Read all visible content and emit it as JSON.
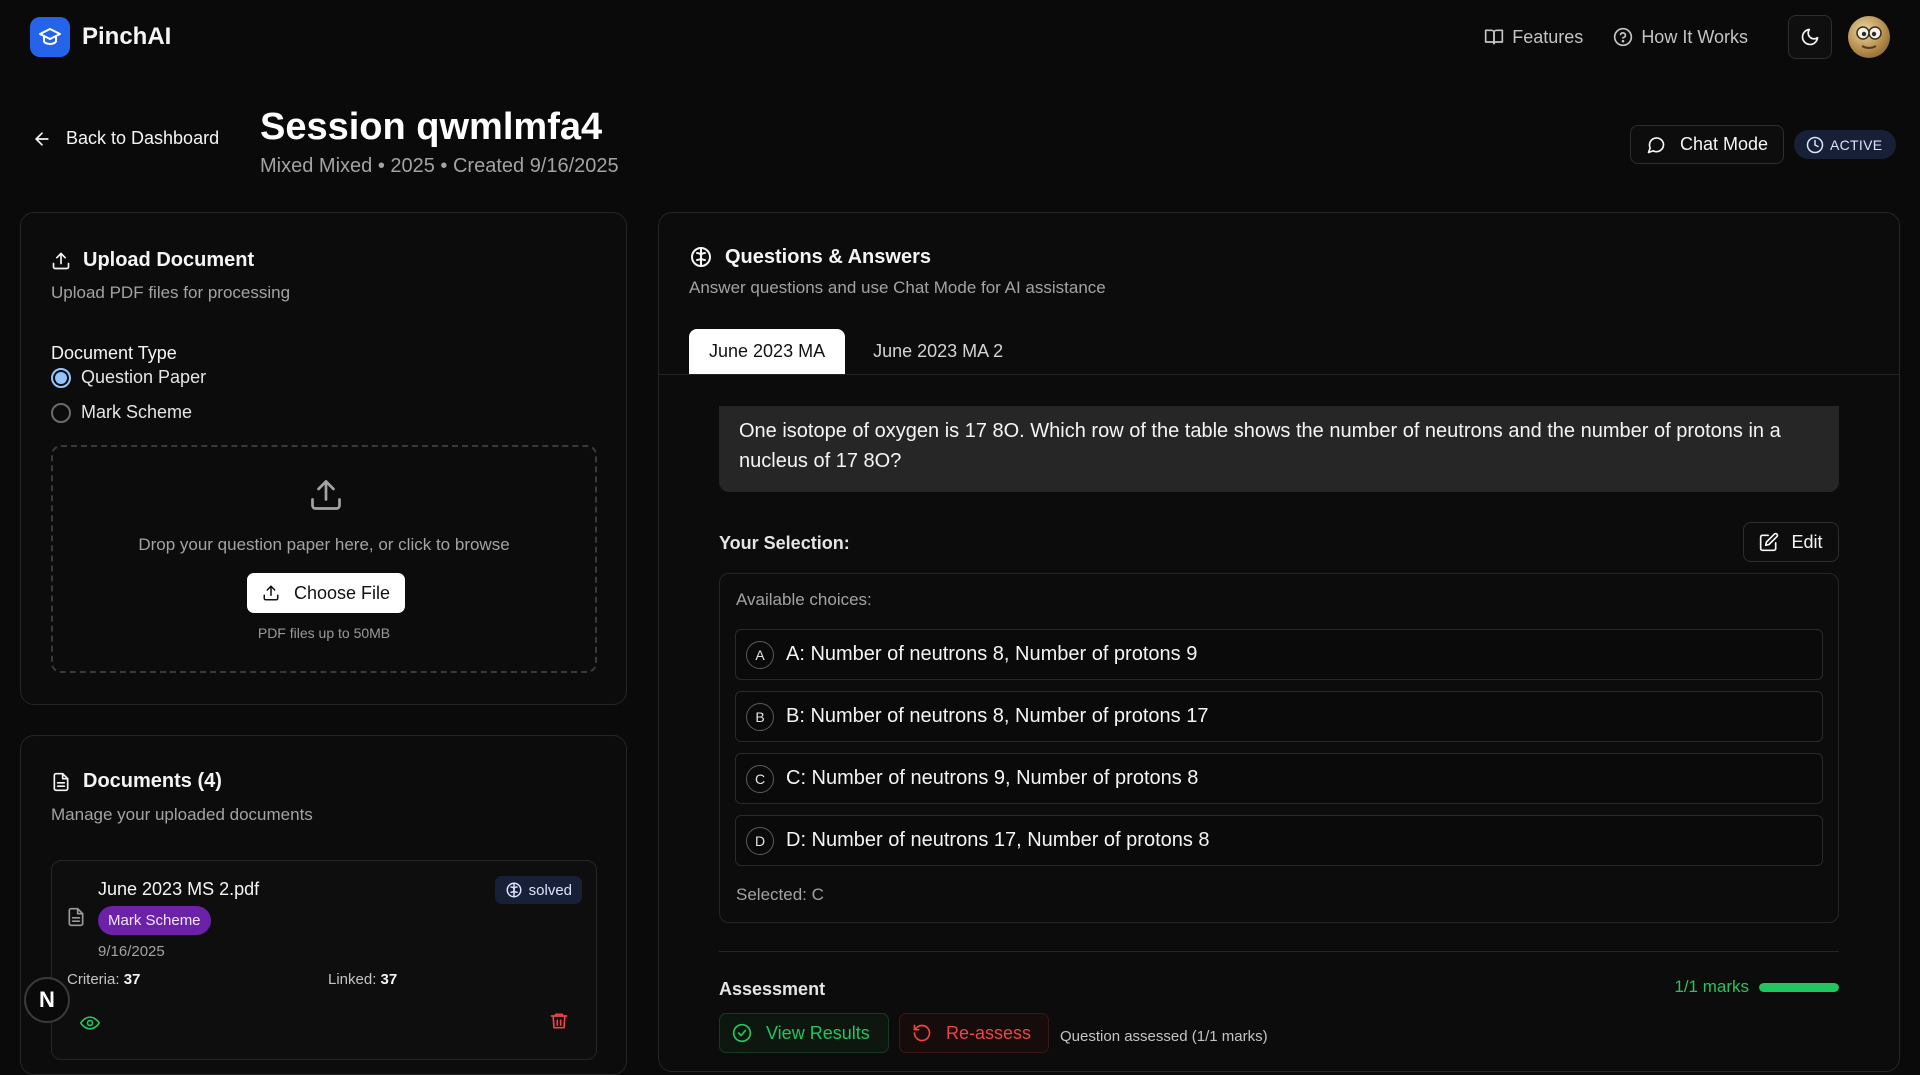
{
  "brand": {
    "name": "PinchAI"
  },
  "nav": {
    "features": "Features",
    "how_it_works": "How It Works"
  },
  "session": {
    "back_label": "Back to Dashboard",
    "title": "Session qwmlmfa4",
    "subtitle": "Mixed Mixed • 2025 • Created 9/16/2025",
    "chat_mode_label": "Chat Mode",
    "status": "ACTIVE"
  },
  "upload": {
    "title": "Upload Document",
    "description": "Upload PDF files for processing",
    "doc_type_label": "Document Type",
    "options": [
      "Question Paper",
      "Mark Scheme"
    ],
    "selected_option": "Question Paper",
    "drop_text": "Drop your question paper here, or click to browse",
    "choose_label": "Choose File",
    "hint": "PDF files up to 50MB"
  },
  "documents": {
    "title": "Documents (4)",
    "description": "Manage your uploaded documents",
    "items": [
      {
        "name": "June 2023 MS 2.pdf",
        "status": "solved",
        "type_tag": "Mark Scheme",
        "date": "9/16/2025",
        "criteria_label": "Criteria:",
        "criteria_value": "37",
        "linked_label": "Linked:",
        "linked_value": "37"
      }
    ]
  },
  "qa": {
    "title": "Questions & Answers",
    "description": "Answer questions and use Chat Mode for AI assistance",
    "tabs": [
      "June 2023 MA",
      "June 2023 MA 2"
    ],
    "active_tab": "June 2023 MA",
    "question_text": "One isotope of oxygen is 17 8O. Which row of the table shows the number of neutrons and the number of protons in a nucleus of 17 8O?",
    "selection_label": "Your Selection:",
    "edit_label": "Edit",
    "choices_title": "Available choices:",
    "choices": [
      {
        "letter": "A",
        "text": "A: Number of neutrons 8, Number of protons 9"
      },
      {
        "letter": "B",
        "text": "B: Number of neutrons 8, Number of protons 17"
      },
      {
        "letter": "C",
        "text": "C: Number of neutrons 9, Number of protons 8"
      },
      {
        "letter": "D",
        "text": "D: Number of neutrons 17, Number of protons 8"
      }
    ],
    "selected_text": "Selected: C",
    "assessment_label": "Assessment",
    "marks_text": "1/1 marks",
    "marks_fraction": 1.0,
    "view_results_label": "View Results",
    "reassess_label": "Re-assess",
    "assessed_text": "Question assessed (1/1 marks)"
  },
  "floating_badge": "N",
  "colors": {
    "accent_blue": "#2563eb",
    "success_green": "#22c55e",
    "danger_red": "#ef4444",
    "tag_purple": "#6b21a8"
  }
}
